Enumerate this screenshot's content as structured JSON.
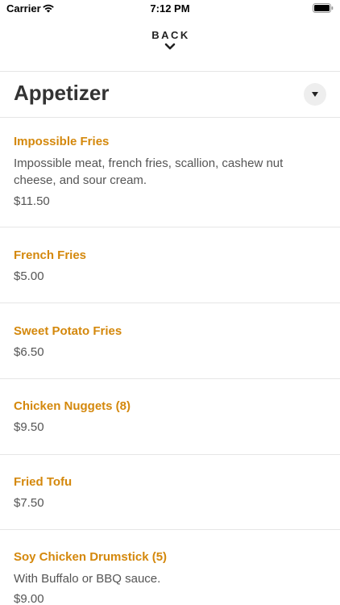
{
  "status_bar": {
    "carrier": "Carrier",
    "time": "7:12 PM"
  },
  "nav": {
    "back_label": "BACK"
  },
  "category": {
    "title": "Appetizer"
  },
  "colors": {
    "item_name": "#d4880c",
    "text": "#555555"
  },
  "items": [
    {
      "name": "Impossible Fries",
      "description": "Impossible meat, french fries, scallion, cashew nut cheese, and sour cream.",
      "price": "$11.50"
    },
    {
      "name": "French Fries",
      "price": "$5.00"
    },
    {
      "name": "Sweet Potato Fries",
      "price": "$6.50"
    },
    {
      "name": "Chicken Nuggets (8)",
      "price": "$9.50"
    },
    {
      "name": "Fried Tofu",
      "price": "$7.50"
    },
    {
      "name": "Soy Chicken Drumstick (5)",
      "description": "With Buffalo or BBQ sauce.",
      "price": "$9.00"
    }
  ]
}
